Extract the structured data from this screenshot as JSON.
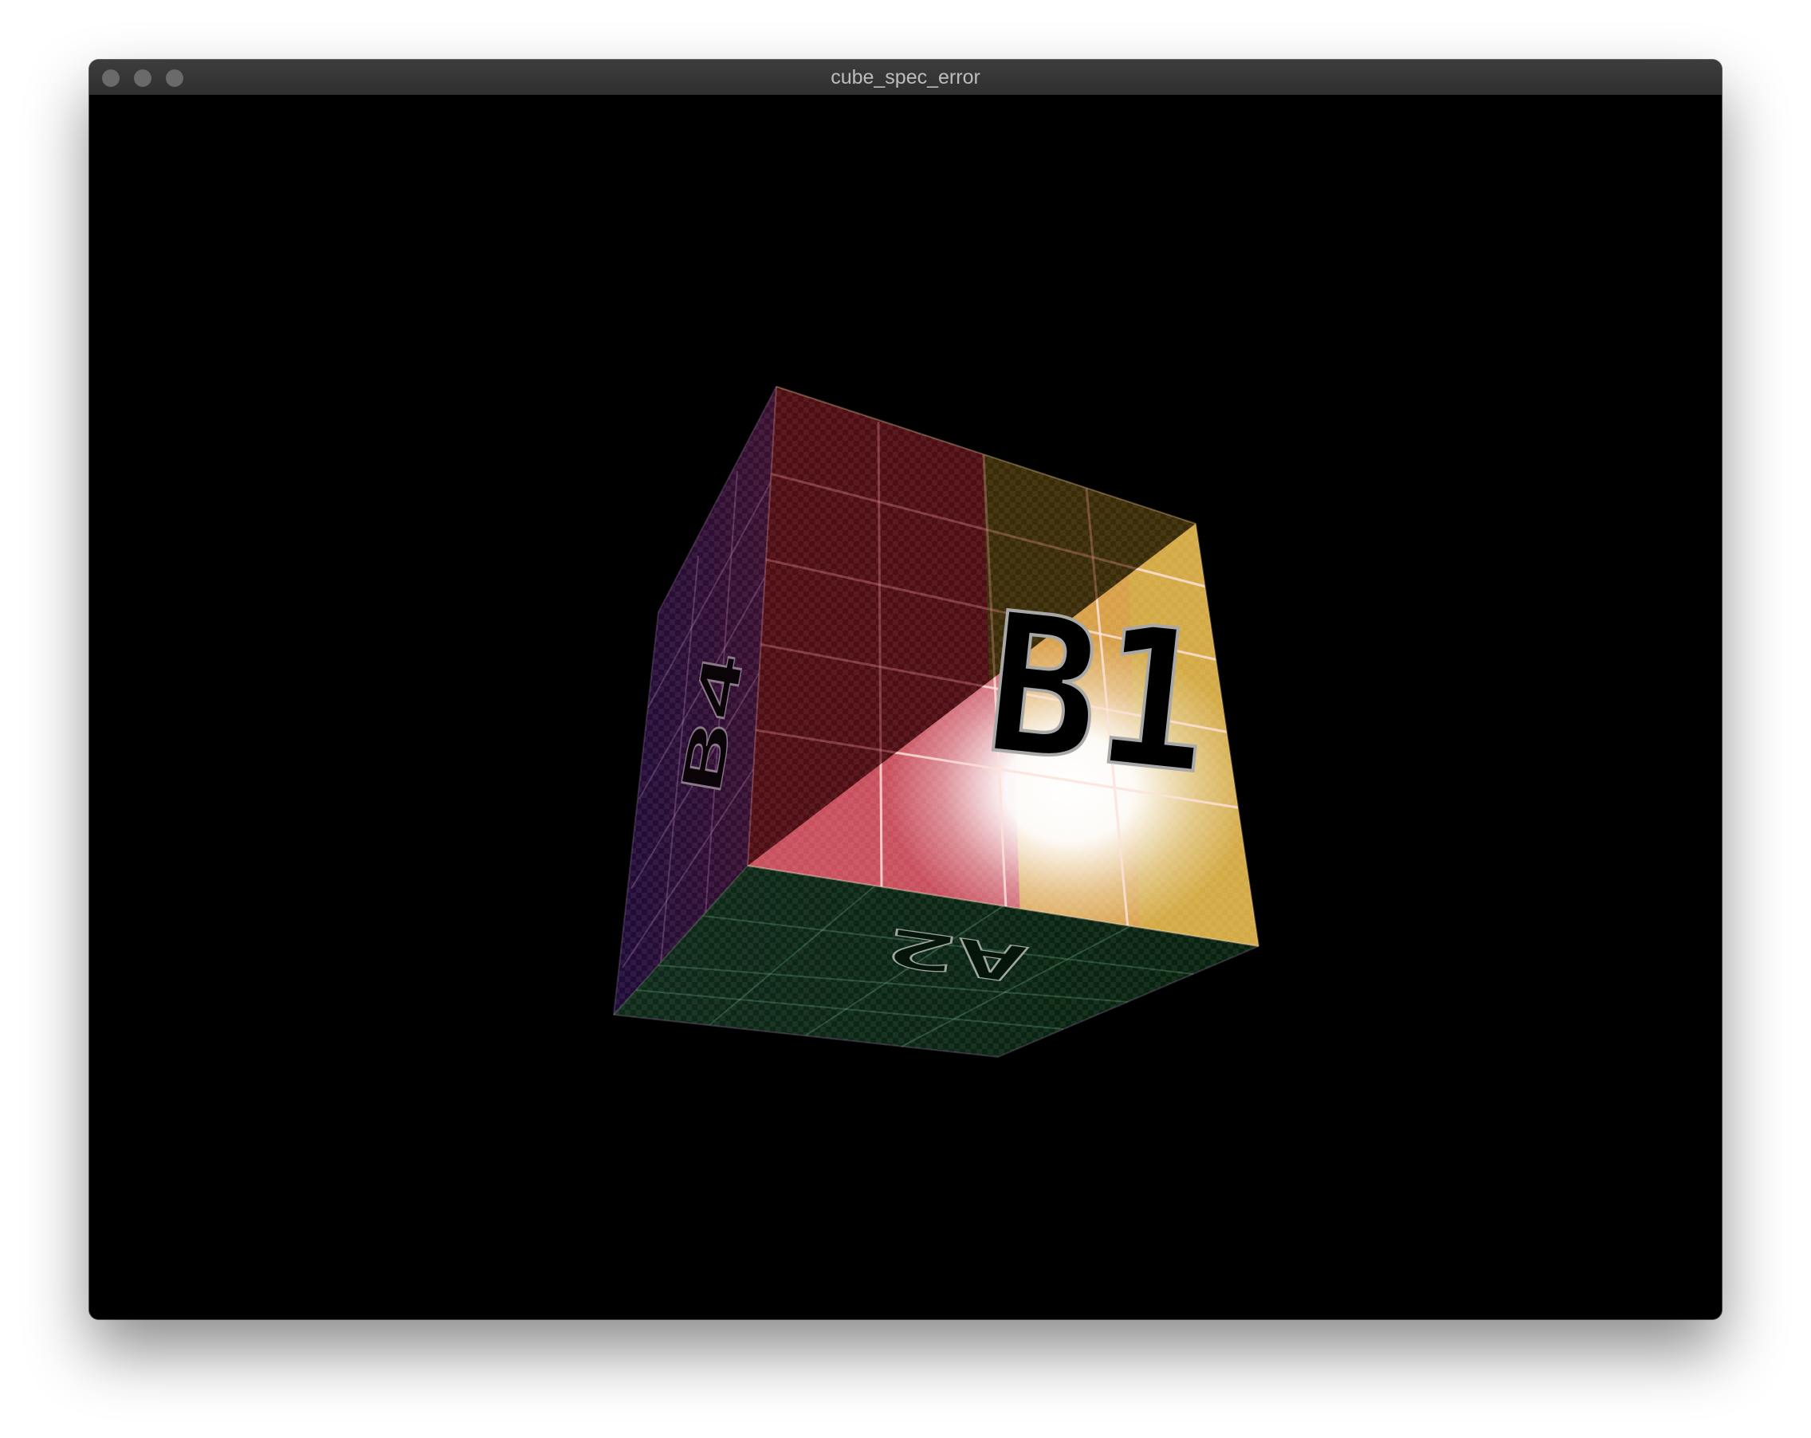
{
  "window": {
    "title": "cube_spec_error"
  },
  "cube": {
    "front_label": "B1",
    "left_label": "B4",
    "bottom_label": "A2",
    "front_color_left": "#5a0f16",
    "front_color_right": "#6b5312",
    "front_lit_left": "#d85a6a",
    "front_lit_right": "#d9b24a",
    "left_color": "#2c0f36",
    "bottom_color": "#062414",
    "highlight": "#ffffff"
  }
}
